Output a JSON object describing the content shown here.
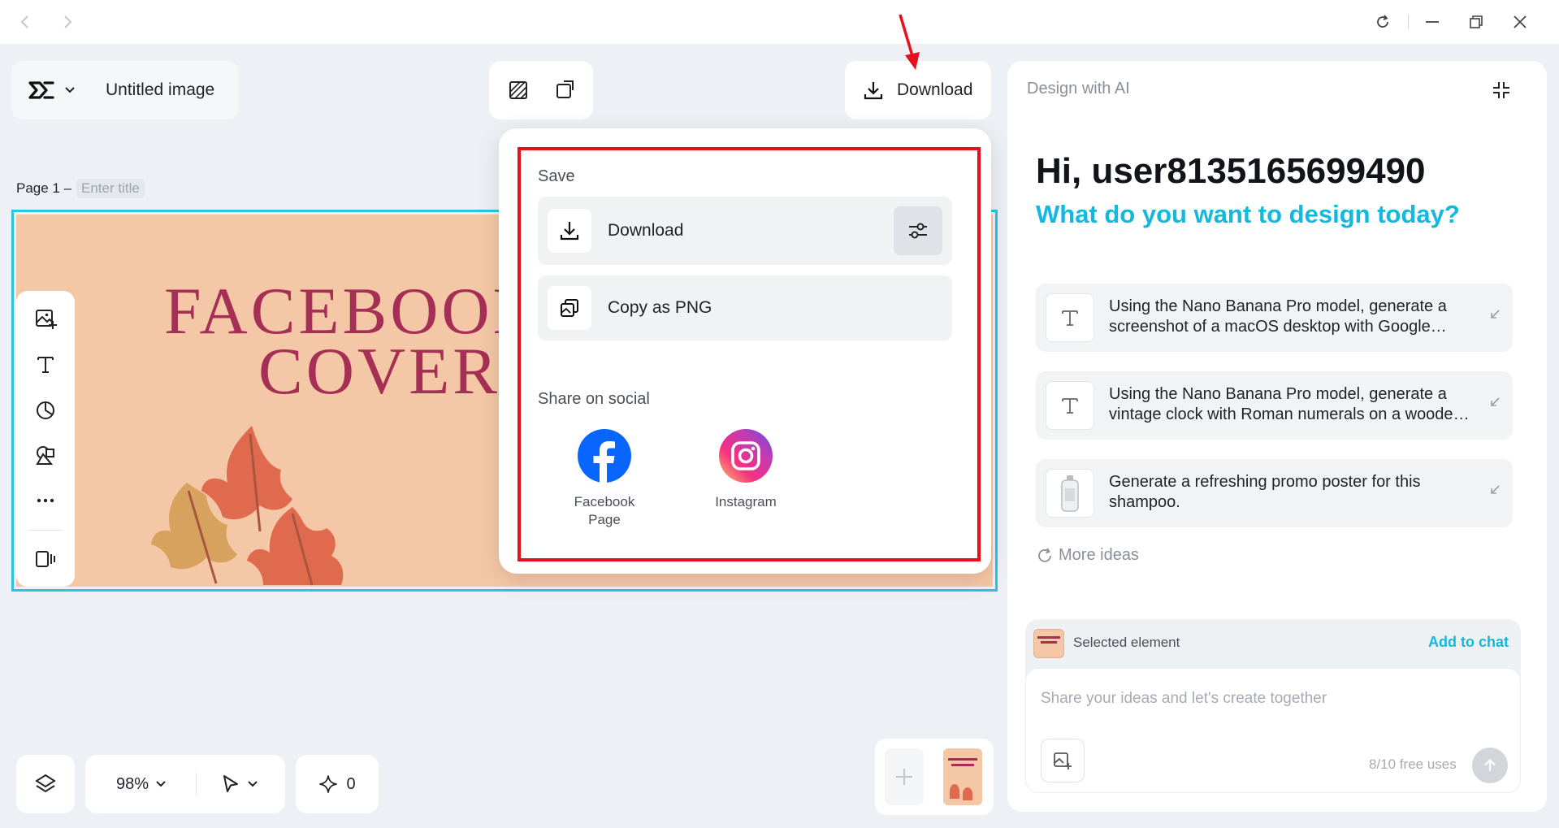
{
  "window": {
    "back_icon": "chevron-left-icon",
    "forward_icon": "chevron-right-icon",
    "controls": [
      "refresh-icon",
      "minimize-icon",
      "restore-icon",
      "close-icon"
    ]
  },
  "header": {
    "project_title": "Untitled image",
    "download_label": "Download"
  },
  "page": {
    "label": "Page 1 –",
    "title_placeholder": "Enter title"
  },
  "canvas": {
    "title_line1": "FACEBOOK",
    "title_line2": "COVER I",
    "background": "#f4c7a6",
    "title_color": "#a62f55"
  },
  "download_menu": {
    "save_heading": "Save",
    "download_label": "Download",
    "copy_label": "Copy as PNG",
    "share_heading": "Share on social",
    "socials": [
      {
        "label_line1": "Facebook",
        "label_line2": "Page"
      },
      {
        "label_line1": "Instagram",
        "label_line2": ""
      }
    ]
  },
  "right_panel": {
    "header": "Design with AI",
    "greeting": "Hi, user8135165699490",
    "subtitle": "What do you want to design today?",
    "ideas": [
      {
        "text": "Using the Nano Banana Pro model, generate a screenshot of a macOS desktop with Google Chrome open"
      },
      {
        "text": "Using the Nano Banana Pro model, generate a vintage clock with Roman numerals on a wooden table"
      },
      {
        "text": "Generate a refreshing promo poster for this shampoo."
      }
    ],
    "more_ideas": "More ideas",
    "selected_element": "Selected element",
    "add_to_chat": "Add to chat",
    "chat_placeholder": "Share your ideas and let's create together",
    "free_uses": "8/10 free uses",
    "accent": "#13b8dc"
  },
  "bottom_bar": {
    "zoom": "98%",
    "credits": "0"
  },
  "colors": {
    "highlight": "#e8101a",
    "selection": "#2bc3e0",
    "facebook": "#0866ff"
  }
}
